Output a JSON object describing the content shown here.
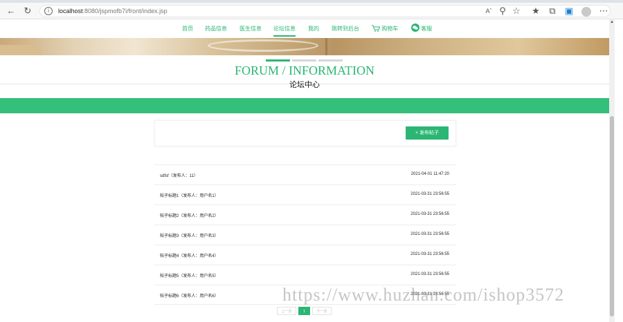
{
  "browser": {
    "url_host": "localhost",
    "url_rest": ":8080/jspmofb7i/front/index.jsp"
  },
  "nav": {
    "items": [
      {
        "label": "首页"
      },
      {
        "label": "药品信息"
      },
      {
        "label": "医生信息"
      },
      {
        "label": "论坛信息"
      },
      {
        "label": "我的"
      },
      {
        "label": "跳转到后台"
      },
      {
        "label": "购物车"
      },
      {
        "label": "客服"
      }
    ],
    "active_index": 3,
    "accent_color": "#2bb673"
  },
  "section": {
    "title_en": "FORUM / INFORMATION",
    "title_cn": "论坛中心"
  },
  "actions": {
    "publish_label": "+ 发布帖子"
  },
  "posts": [
    {
      "title": "sdfsf（发布人：11）",
      "date": "2021-04-01 11:47:20"
    },
    {
      "title": "帖子标题1（发布人：用户名1）",
      "date": "2021-03-31 23:56:55"
    },
    {
      "title": "帖子标题2（发布人：用户名2）",
      "date": "2021-03-31 23:56:55"
    },
    {
      "title": "帖子标题3（发布人：用户名3）",
      "date": "2021-03-31 23:56:55"
    },
    {
      "title": "帖子标题4（发布人：用户名4）",
      "date": "2021-03-31 23:56:55"
    },
    {
      "title": "帖子标题5（发布人：用户名5）",
      "date": "2021-03-31 23:56:55"
    },
    {
      "title": "帖子标题6（发布人：用户名6）",
      "date": "2021-03-31 23:56:55"
    }
  ],
  "pagination": {
    "prev_label": "上一页",
    "current": "1",
    "next_label": "下一页"
  },
  "watermark": "https://www.huzhan.com/ishop3572"
}
